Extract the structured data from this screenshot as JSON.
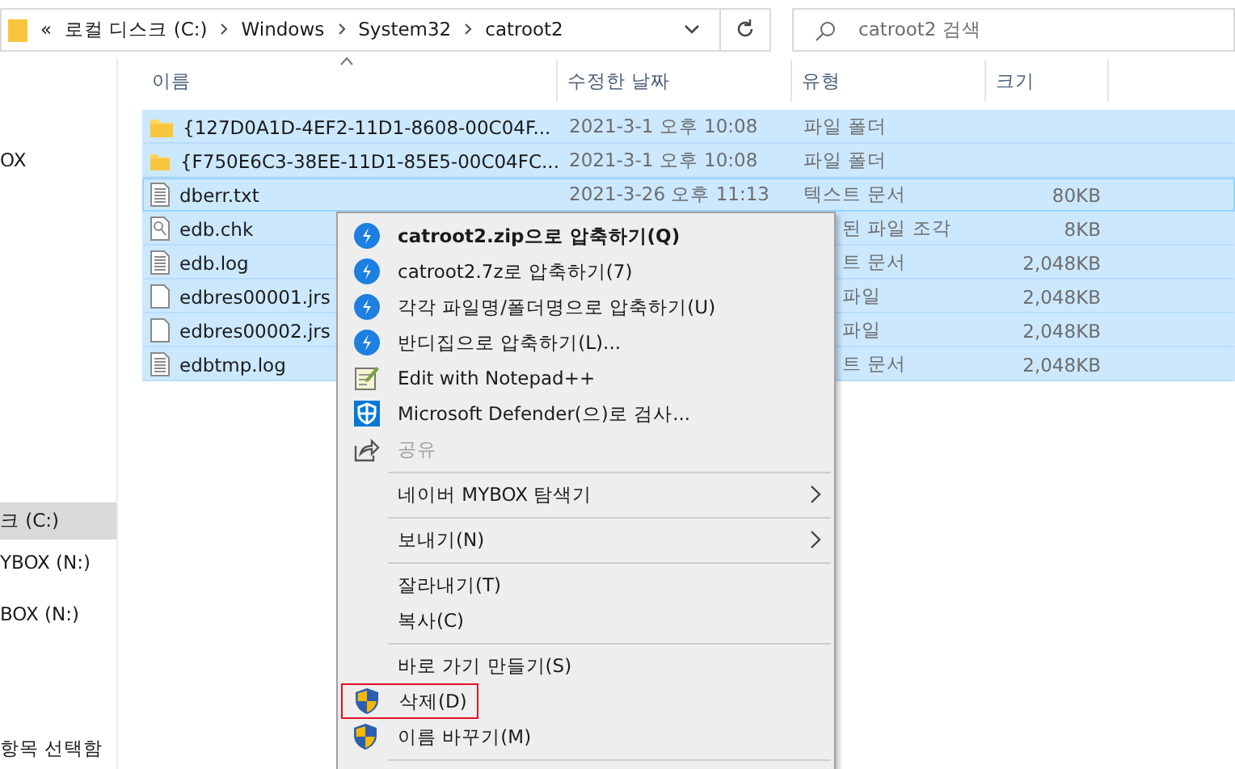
{
  "address_bar": {
    "overflow": "«",
    "crumbs": [
      "로컬 디스크 (C:)",
      "Windows",
      "System32",
      "catroot2"
    ]
  },
  "search": {
    "placeholder": "catroot2 검색"
  },
  "sidebar": {
    "items": [
      {
        "label": "OX",
        "selected": false
      },
      {
        "label": "크 (C:)",
        "selected": true
      },
      {
        "label": "YBOX (N:)",
        "selected": false
      },
      {
        "label": "BOX (N:)",
        "selected": false
      }
    ]
  },
  "table": {
    "columns": [
      "이름",
      "수정한 날짜",
      "유형",
      "크기"
    ],
    "rows": [
      {
        "kind": "folder",
        "name": "{127D0A1D-4EF2-11D1-8608-00C04F...",
        "date": "2021-3-1 오후 10:08",
        "type": "파일 폴더",
        "type_clipped": false,
        "size": "",
        "selected": true,
        "focused": false
      },
      {
        "kind": "folder",
        "name": "{F750E6C3-38EE-11D1-85E5-00C04FC...",
        "date": "2021-3-1 오후 10:08",
        "type": "파일 폴더",
        "type_clipped": false,
        "size": "",
        "selected": true,
        "focused": false
      },
      {
        "kind": "text",
        "name": "dberr.txt",
        "date": "2021-3-26 오후 11:13",
        "type": "텍스트 문서",
        "type_clipped": false,
        "size": "80KB",
        "selected": true,
        "focused": true
      },
      {
        "kind": "chk",
        "name": "edb.chk",
        "type": "된 파일 조각",
        "type_clipped": true,
        "size": "8KB",
        "selected": true,
        "focused": false
      },
      {
        "kind": "text",
        "name": "edb.log",
        "type": "트 문서",
        "type_clipped": true,
        "size": "2,048KB",
        "selected": true,
        "focused": false
      },
      {
        "kind": "blank",
        "name": "edbres00001.jrs",
        "type": "파일",
        "type_clipped": true,
        "size": "2,048KB",
        "selected": true,
        "focused": false
      },
      {
        "kind": "blank",
        "name": "edbres00002.jrs",
        "type": "파일",
        "type_clipped": true,
        "size": "2,048KB",
        "selected": true,
        "focused": false
      },
      {
        "kind": "text",
        "name": "edbtmp.log",
        "type": "트 문서",
        "type_clipped": true,
        "size": "2,048KB",
        "selected": true,
        "focused": false
      }
    ]
  },
  "status_bar": {
    "text": "항목 선택함"
  },
  "context_menu": {
    "items": [
      {
        "kind": "compress",
        "label": "catroot2.zip으로 압축하기(Q)",
        "bold": true
      },
      {
        "kind": "compress",
        "label": "catroot2.7z로 압축하기(7)",
        "bold": false
      },
      {
        "kind": "compress",
        "label": "각각 파일명/폴더명으로 압축하기(U)",
        "bold": false
      },
      {
        "kind": "compress",
        "label": "반디집으로 압축하기(L)...",
        "bold": false
      },
      {
        "kind": "notepad",
        "label": "Edit with Notepad++",
        "bold": false
      },
      {
        "kind": "defender",
        "label": "Microsoft Defender(으)로 검사...",
        "bold": false
      },
      {
        "kind": "share",
        "label": "공유",
        "disabled": true
      },
      {
        "kind": "separator"
      },
      {
        "kind": "plain",
        "label": "네이버 MYBOX 탐색기",
        "submenu": true
      },
      {
        "kind": "separator"
      },
      {
        "kind": "plain",
        "label": "보내기(N)",
        "submenu": true
      },
      {
        "kind": "separator"
      },
      {
        "kind": "plain",
        "label": "잘라내기(T)"
      },
      {
        "kind": "plain",
        "label": "복사(C)"
      },
      {
        "kind": "separator"
      },
      {
        "kind": "plain",
        "label": "바로 가기 만들기(S)"
      },
      {
        "kind": "admin",
        "label": "삭제(D)",
        "outlined": true
      },
      {
        "kind": "admin",
        "label": "이름 바꾸기(M)"
      },
      {
        "kind": "separator"
      }
    ]
  }
}
